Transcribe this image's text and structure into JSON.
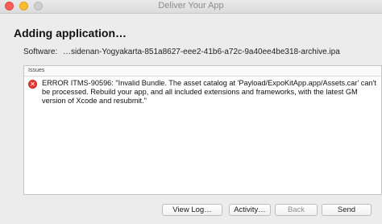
{
  "window": {
    "title": "Deliver Your App"
  },
  "heading": "Adding application…",
  "software": {
    "label": "Software:",
    "value": "…sidenan-Yogyakarta-851a8627-eee2-41b6-a72c-9a40ee4be318-archive.ipa"
  },
  "issues": {
    "header": "Issues",
    "items": [
      {
        "icon": "error-icon",
        "text": "ERROR ITMS-90596: \"Invalid Bundle. The asset catalog at 'Payload/ExpoKitApp.app/Assets.car' can't be processed. Rebuild your app, and all included extensions and frameworks, with the latest GM version of Xcode and resubmit.\""
      }
    ]
  },
  "buttons": {
    "view_log": "View Log…",
    "activity": "Activity…",
    "back": "Back",
    "send": "Send"
  },
  "colors": {
    "error": "#e23a33",
    "close": "#fc5f57",
    "minimize": "#fdbd2e",
    "zoom_disabled": "#cfcfcf"
  }
}
